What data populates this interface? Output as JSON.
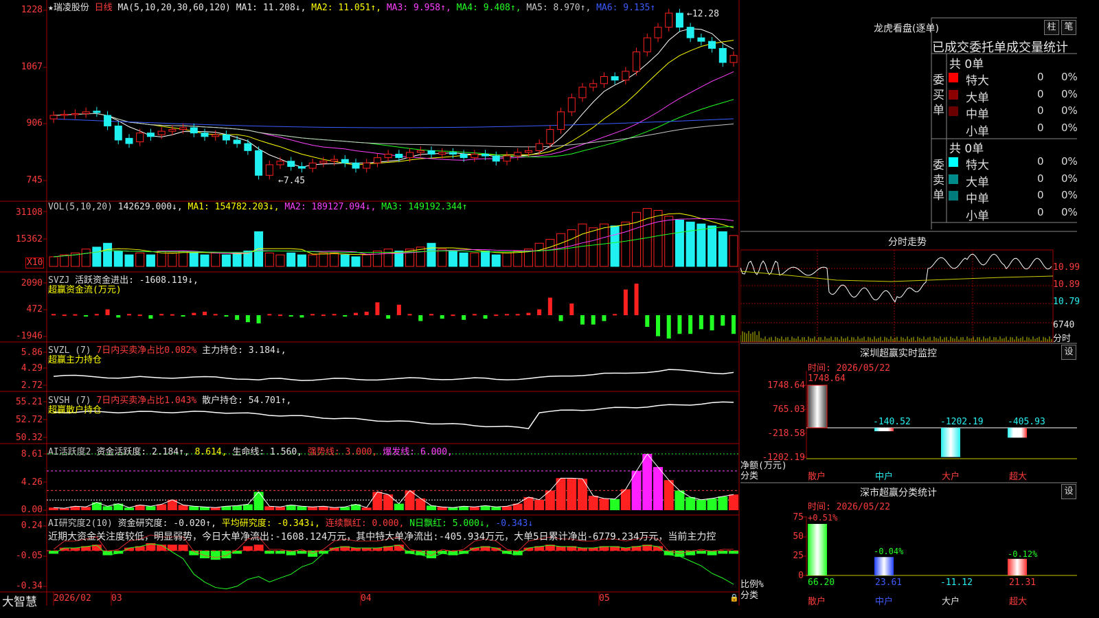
{
  "colors": {
    "up": "#ff2020",
    "down": "#20f0f0",
    "ma1": "#ffffff",
    "ma2": "#ffff00",
    "ma3": "#ff40ff",
    "ma4": "#22ff22",
    "ma5": "#c8c8c8",
    "ma6": "#3b5bff",
    "grid": "#7a0000",
    "frame": "#a00000"
  },
  "header": {
    "stock_name": "★瑞凌股份",
    "period": "日线",
    "ma_spec": "MA(5,10,20,30,60,120)",
    "ma1": "MA1: 11.208↓,",
    "ma2": "MA2: 11.051↑,",
    "ma3": "MA3: 9.958↑,",
    "ma4": "MA4: 9.408↑,",
    "ma5": "MA5: 8.970↑,",
    "ma6": "MA6: 9.135↑",
    "high_mark": "12.28",
    "low_mark": "7.45"
  },
  "price_axis": [
    "1228",
    "1067",
    "906",
    "745"
  ],
  "vol": {
    "title": "VOL(5,10,20)",
    "value": "142629.000↓,",
    "ma1": "MA1: 154782.203↓,",
    "ma2": "MA2: 189127.094↓,",
    "ma3": "MA3: 149192.344↑",
    "axis": [
      "31108",
      "15362"
    ],
    "unit": "X10"
  },
  "svzj": {
    "title": "SVZJ",
    "desc": "活跃资金进出: -1608.119↓,",
    "sub": "超赢资金流(万元)",
    "axis": [
      "2090",
      "472",
      "-1946"
    ]
  },
  "svzl": {
    "title": "SVZL (7)",
    "desc1": "7日内买卖净占比0.082%",
    "desc2": "主力持仓: 3.184↓,",
    "sub": "超赢主力持仓",
    "axis": [
      "5.86",
      "4.29",
      "2.72"
    ]
  },
  "svsh": {
    "title": "SVSH (7)",
    "desc1": "7日内买卖净占比1.043%",
    "desc2": "散户持仓: 54.701↑,",
    "sub": "超赢散户持仓",
    "axis": [
      "55.21",
      "52.72",
      "50.32"
    ]
  },
  "ai_active": {
    "title": "AI活跃度2",
    "d1": "资金活跃度: 2.184↑,",
    "d2": "8.614,",
    "d3": "生命线: 1.560,",
    "d4": "强势线: 3.000,",
    "d5": "爆发线: 6.000,",
    "axis": [
      "8.61",
      "4.26",
      "0.00"
    ]
  },
  "ai_research": {
    "title": "AI研究度2(10)",
    "d1": "资金研究度: -0.020↑,",
    "d2": "平均研究度: -0.343↓,",
    "d3": "连续飘红: 0.000,",
    "d4": "N日飘红: 5.000↓,",
    "d5": "-0.343↓",
    "summary": "近期大资金关注度较低，明显弱势，今日大单净流出:-1608.124万元，其中特大单净流出:-405.934万元，大单5日累计净出-6779.234万元，当前主力控",
    "axis": [
      "0.24",
      "-0.05",
      "-0.34"
    ]
  },
  "bottom_axis": {
    "brand": "大智慧",
    "dates": [
      "2026/02",
      "03",
      "04",
      "05"
    ]
  },
  "lhb": {
    "title": "龙虎看盘(逐单)",
    "btn1": "柱",
    "btn2": "笔",
    "tabs": "已成交委托单成交量统计",
    "buy_label": "委买单",
    "sell_label": "委卖单",
    "buy_total": "共 0单",
    "sell_total": "共 0单",
    "buy_rows": [
      {
        "name": "特大",
        "count": "0",
        "pct": "0%",
        "color": "#ff0000"
      },
      {
        "name": "大单",
        "count": "0",
        "pct": "0%",
        "color": "#8b0000"
      },
      {
        "name": "中单",
        "count": "0",
        "pct": "0%",
        "color": "#6b0000"
      },
      {
        "name": "小单",
        "count": "0",
        "pct": "0%",
        "color": ""
      }
    ],
    "sell_rows": [
      {
        "name": "特大",
        "count": "0",
        "pct": "0%",
        "color": "#00ffff"
      },
      {
        "name": "大单",
        "count": "0",
        "pct": "0%",
        "color": "#008b8b"
      },
      {
        "name": "中单",
        "count": "0",
        "pct": "0%",
        "color": "#007a7a"
      },
      {
        "name": "小单",
        "count": "0",
        "pct": "0%",
        "color": ""
      }
    ]
  },
  "fenshi": {
    "title": "分时走势",
    "axis": [
      "10.99",
      "10.89",
      "10.79"
    ],
    "vol_label": "6740",
    "vol_label2": "分时"
  },
  "monitor": {
    "title": "深圳超赢实时监控",
    "btn": "设",
    "time": "时间: 2026/05/22",
    "axis": [
      "1748.64",
      "765.03",
      "-218.58",
      "-1202.19"
    ],
    "ylabel1": "净额(万元)",
    "ylabel2": "分类",
    "cats": [
      "散户",
      "中户",
      "大户",
      "超大"
    ],
    "values": [
      "1748.64",
      "-140.52",
      "-1202.19",
      "-405.93"
    ]
  },
  "classify": {
    "title": "深市超赢分类统计",
    "btn": "设",
    "time": "时间: 2026/05/22",
    "axis": [
      "75",
      "50",
      "25",
      "0"
    ],
    "ylabel1": "比例%",
    "ylabel2": "分类",
    "cats": [
      "散户",
      "中户",
      "大户",
      "超大"
    ],
    "tops": [
      "+0.51%",
      "-0.04%",
      "",
      "-0.12%"
    ],
    "values": [
      "66.20",
      "23.61",
      "-11.12",
      "21.31"
    ]
  },
  "chart_data": [
    {
      "type": "candlestick",
      "title": "瑞凌股份 日线",
      "y_axis_ticks": [
        "1228",
        "1067",
        "906",
        "745"
      ],
      "high": 12.28,
      "low": 7.45,
      "close": [
        9.3,
        9.33,
        9.35,
        9.4,
        9.38,
        9.0,
        8.6,
        8.5,
        8.8,
        8.7,
        8.85,
        8.9,
        8.95,
        8.8,
        8.7,
        8.75,
        8.6,
        8.5,
        8.3,
        7.6,
        7.9,
        8.0,
        7.85,
        7.8,
        7.95,
        8.0,
        8.05,
        7.95,
        7.8,
        7.95,
        8.1,
        8.2,
        8.1,
        8.25,
        8.3,
        8.2,
        8.25,
        8.2,
        8.1,
        8.2,
        8.15,
        8.0,
        8.15,
        8.25,
        8.3,
        8.5,
        8.9,
        9.4,
        9.8,
        10.1,
        10.2,
        10.4,
        10.3,
        10.55,
        11.1,
        11.5,
        11.8,
        12.2,
        11.8,
        11.5,
        11.4,
        11.2,
        10.8,
        11.0
      ],
      "open": [
        9.2,
        9.3,
        9.32,
        9.35,
        9.42,
        9.3,
        9.0,
        8.65,
        8.55,
        8.8,
        8.75,
        8.85,
        8.9,
        8.95,
        8.8,
        8.7,
        8.75,
        8.6,
        8.5,
        8.3,
        7.6,
        7.9,
        8.0,
        7.85,
        7.8,
        7.95,
        8.0,
        8.05,
        7.95,
        7.8,
        7.95,
        8.1,
        8.2,
        8.1,
        8.25,
        8.3,
        8.2,
        8.25,
        8.2,
        8.1,
        8.2,
        8.15,
        8.0,
        8.15,
        8.25,
        8.3,
        8.5,
        8.9,
        9.4,
        9.8,
        10.1,
        10.2,
        10.4,
        10.3,
        10.55,
        11.1,
        11.5,
        11.8,
        12.2,
        11.8,
        11.5,
        11.4,
        11.2,
        10.8
      ]
    },
    {
      "type": "bar",
      "title": "VOL(5,10,20)",
      "y_axis_ticks": [
        "31108",
        "15362"
      ],
      "values": [
        5,
        6,
        7,
        9,
        10,
        12,
        8,
        6,
        7,
        6,
        8,
        7,
        8,
        7,
        6,
        7,
        6,
        7,
        8,
        18,
        7,
        6,
        7,
        6,
        6,
        7,
        7,
        6,
        5,
        6,
        8,
        9,
        8,
        9,
        10,
        12,
        9,
        8,
        7,
        7,
        8,
        6,
        7,
        8,
        9,
        12,
        14,
        17,
        19,
        22,
        20,
        22,
        21,
        23,
        28,
        30,
        29,
        26,
        24,
        23,
        22,
        21,
        18,
        16
      ]
    },
    {
      "type": "bar",
      "title": "SVZJ 超赢资金流(万元)",
      "y_axis_ticks": [
        "2090",
        "472",
        "-1946"
      ],
      "values": [
        0.1,
        0.05,
        0.08,
        -0.1,
        0.1,
        0.5,
        -0.2,
        0.1,
        0.05,
        -0.3,
        0.1,
        0.08,
        -0.1,
        0.2,
        0.3,
        0.1,
        -0.1,
        -0.4,
        -0.6,
        -0.7,
        0.1,
        0.05,
        -0.1,
        -0.2,
        0.1,
        0.05,
        0.1,
        -0.1,
        0.2,
        0.3,
        1.1,
        -0.3,
        0.9,
        0.1,
        -0.5,
        0.1,
        -0.3,
        0.05,
        -0.4,
        0.1,
        -0.3,
        0.05,
        0.1,
        0.1,
        0.2,
        0.5,
        1.5,
        -0.5,
        1.0,
        -0.8,
        -0.8,
        -0.5,
        0.1,
        2.2,
        2.7,
        -1.0,
        -1.8,
        -2.0,
        -1.6,
        -1.6,
        -1.2,
        -1.3,
        -0.9,
        -1.6
      ]
    },
    {
      "type": "line",
      "title": "SVZL 超赢主力持仓",
      "y_axis_ticks": [
        "5.86",
        "4.29",
        "2.72"
      ]
    },
    {
      "type": "line",
      "title": "SVSH 超赢散户持仓",
      "y_axis_ticks": [
        "55.21",
        "52.72",
        "50.32"
      ]
    },
    {
      "type": "bar",
      "title": "AI活跃度2",
      "y_axis_ticks": [
        "8.61",
        "4.26",
        "0.00"
      ],
      "values": [
        0.4,
        0.3,
        0.6,
        0.5,
        1.2,
        0.6,
        1.0,
        0.4,
        0.8,
        0.6,
        0.9,
        1.6,
        0.8,
        0.6,
        0.5,
        0.4,
        0.6,
        0.7,
        0.9,
        2.8,
        0.6,
        0.5,
        0.8,
        0.6,
        0.5,
        0.6,
        0.4,
        0.5,
        0.9,
        0.4,
        2.8,
        2.4,
        1.0,
        3.0,
        1.8,
        0.7,
        0.5,
        0.4,
        0.6,
        0.5,
        0.7,
        0.5,
        0.6,
        1.0,
        2.0,
        1.6,
        3.0,
        4.9,
        4.9,
        4.8,
        2.2,
        1.8,
        1.7,
        3.2,
        6.0,
        8.6,
        6.6,
        4.6,
        3.0,
        2.0,
        1.6,
        1.8,
        2.1,
        2.4
      ]
    },
    {
      "type": "bar",
      "title": "AI研究度2(10)",
      "y_axis_ticks": [
        "0.24",
        "-0.05",
        "-0.34"
      ],
      "values": [
        -0.02,
        0.02,
        0.02,
        0.03,
        0.04,
        -0.03,
        -0.02,
        0.02,
        0.03,
        0.05,
        0.04,
        0.04,
        0.04,
        -0.03,
        -0.05,
        -0.06,
        -0.05,
        -0.02,
        0.03,
        0.04,
        -0.02,
        -0.02,
        -0.03,
        -0.02,
        -0.04,
        -0.02,
        0.02,
        0.03,
        0.02,
        0.02,
        0.02,
        0.03,
        0.04,
        -0.02,
        -0.03,
        -0.05,
        -0.02,
        -0.03,
        -0.02,
        0.02,
        0.03,
        0.02,
        -0.02,
        -0.03,
        0.02,
        0.03,
        0.04,
        0.03,
        0.03,
        0.02,
        0.02,
        0.03,
        0.03,
        0.02,
        0.03,
        0.04,
        0.03,
        -0.03,
        -0.04,
        -0.03,
        -0.02,
        -0.03,
        -0.02,
        -0.02
      ]
    }
  ]
}
